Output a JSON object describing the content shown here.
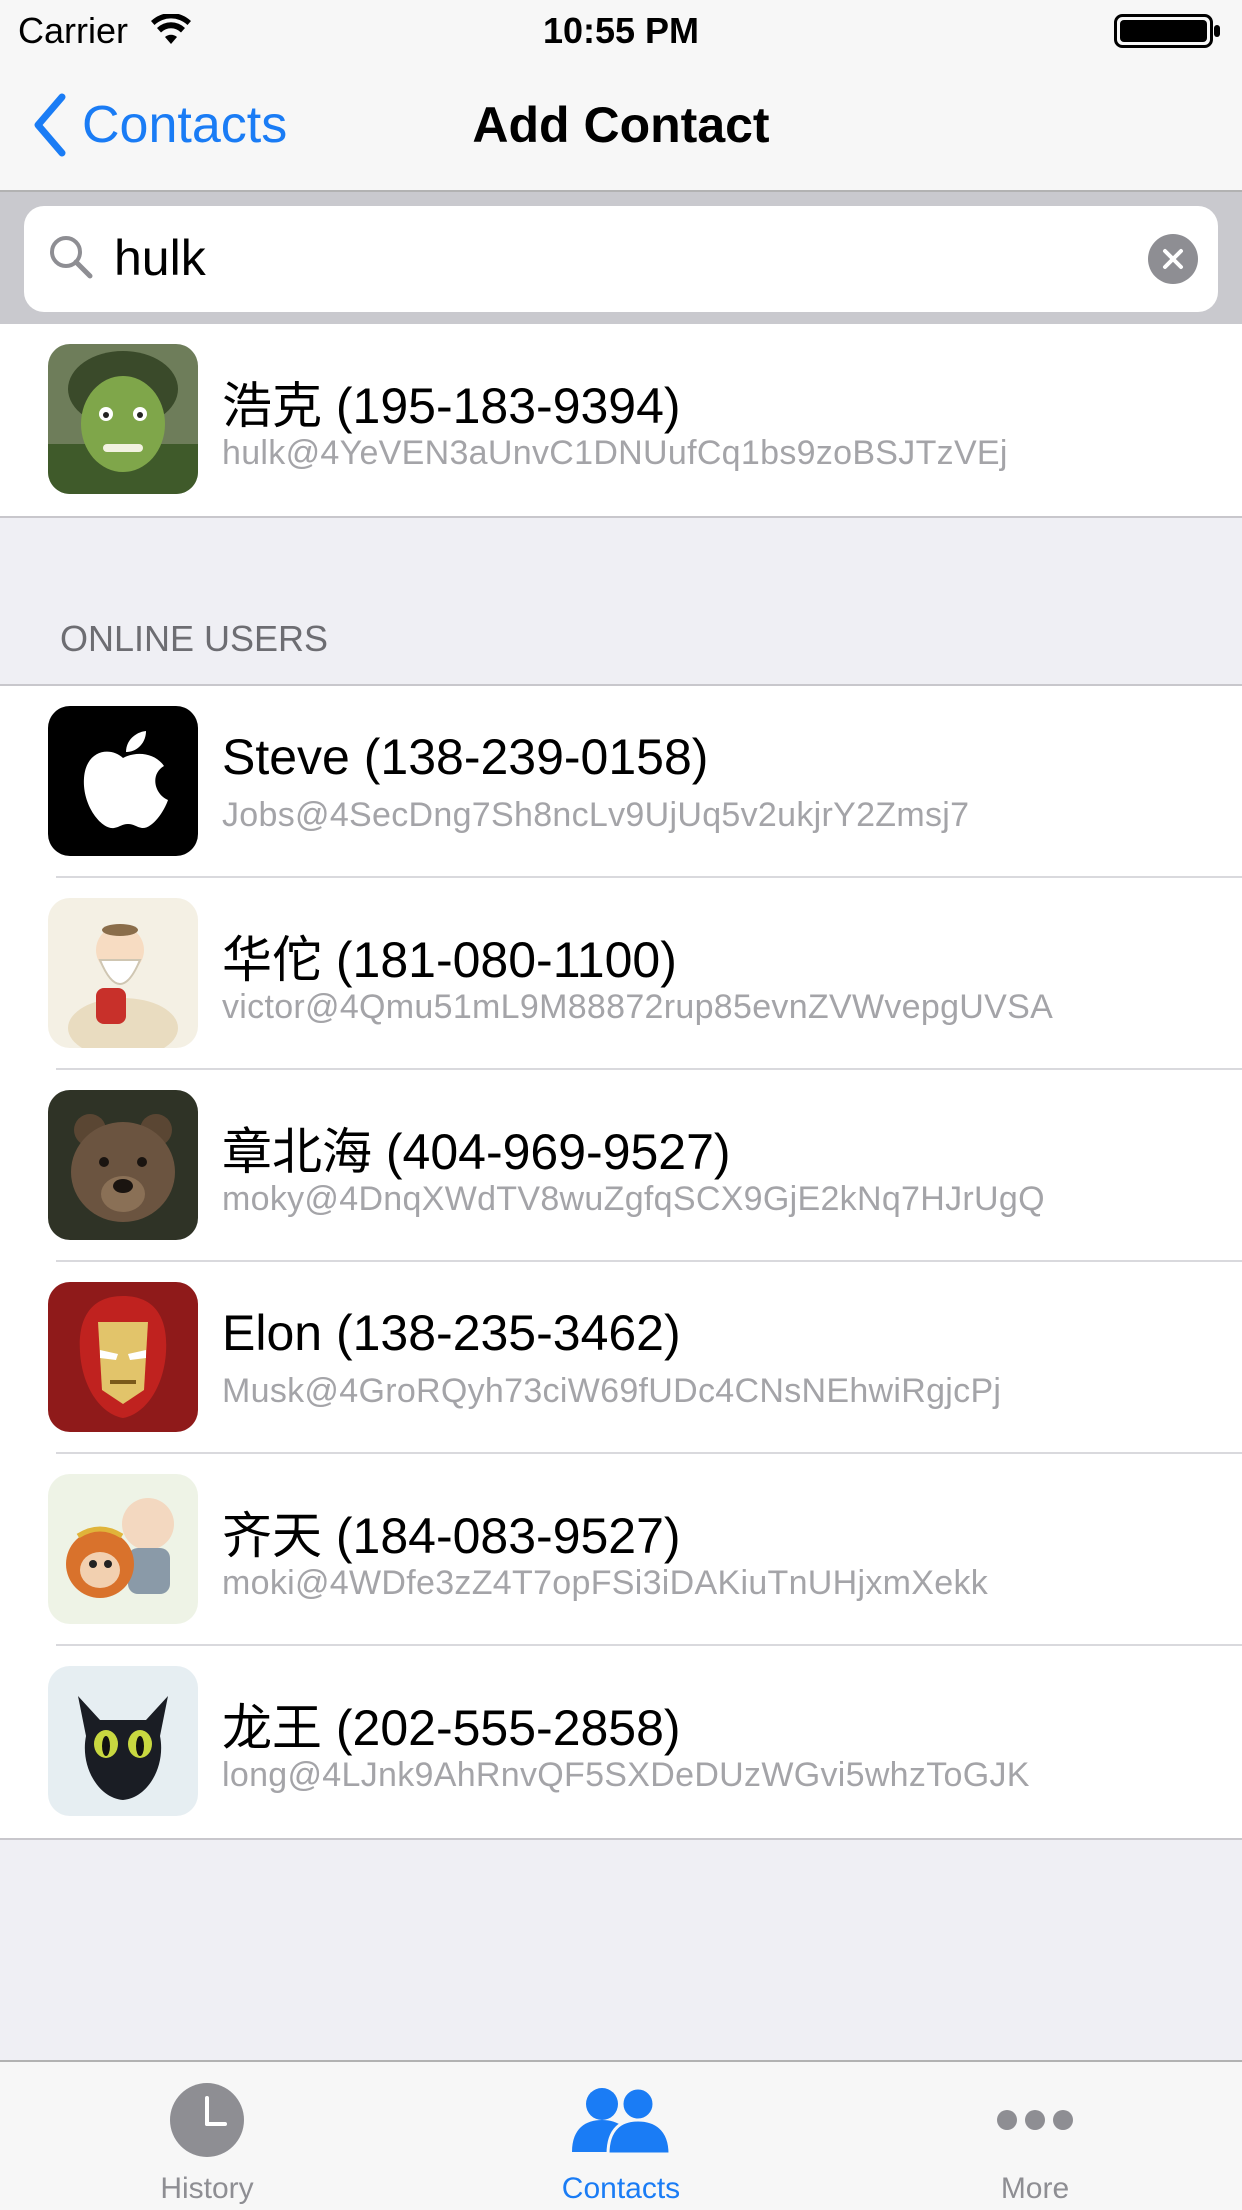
{
  "status_bar": {
    "carrier": "Carrier",
    "time": "10:55 PM"
  },
  "nav": {
    "back_label": "Contacts",
    "title": "Add Contact"
  },
  "search": {
    "value": "hulk"
  },
  "results": [
    {
      "name": "浩克 (195-183-9394)",
      "id": "hulk@4YeVEN3aUnvC1DNUufCq1bs9zoBSJTzVEj",
      "avatar": "hulk-avatar"
    }
  ],
  "online_section": {
    "header": "ONLINE USERS"
  },
  "online_users": [
    {
      "name": "Steve (138-239-0158)",
      "id": "Jobs@4SecDng7Sh8ncLv9UjUq5v2ukjrY2Zmsj7",
      "avatar": "apple-logo-avatar"
    },
    {
      "name": "华佗 (181-080-1100)",
      "id": "victor@4Qmu51mL9M88872rup85evnZVWvepgUVSA",
      "avatar": "old-man-avatar"
    },
    {
      "name": "章北海 (404-969-9527)",
      "id": "moky@4DnqXWdTV8wuZgfqSCX9GjE2kNq7HJrUgQ",
      "avatar": "bear-avatar"
    },
    {
      "name": "Elon (138-235-3462)",
      "id": "Musk@4GroRQyh73ciW69fUDc4CNsNEhwiRgjcPj",
      "avatar": "iron-man-avatar"
    },
    {
      "name": "齐天 (184-083-9527)",
      "id": "moki@4WDfe3zZ4T7opFSi3iDAKiuTnUHjxmXekk",
      "avatar": "monkey-king-avatar"
    },
    {
      "name": "龙王 (202-555-2858)",
      "id": "long@4LJnk9AhRnvQF5SXDeDUzWGvi5whzToGJK",
      "avatar": "dragon-avatar"
    }
  ],
  "tabs": [
    {
      "label": "History",
      "icon": "clock-icon",
      "active": false
    },
    {
      "label": "Contacts",
      "icon": "contacts-icon",
      "active": true
    },
    {
      "label": "More",
      "icon": "more-icon",
      "active": false
    }
  ],
  "colors": {
    "accent": "#1a7cf5",
    "inactive": "#8e8e93",
    "background": "#efeff4"
  }
}
